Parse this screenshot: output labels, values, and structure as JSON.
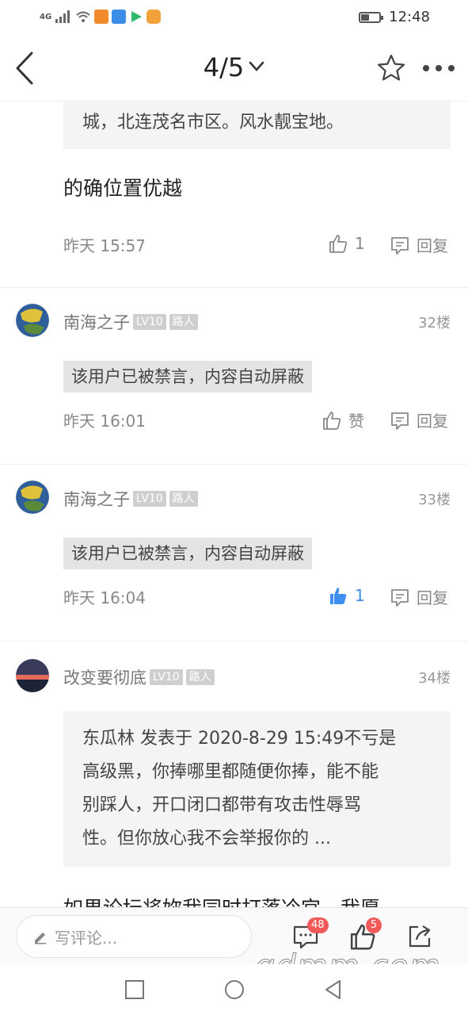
{
  "status_bar": {
    "network": "4G",
    "time": "12:48",
    "battery_level": 0.45
  },
  "header": {
    "page_indicator": "4/5"
  },
  "content": {
    "top_quote": "城，北连茂名市区。风水靓宝地。",
    "top_post_text": "的确位置优越",
    "top_post_time": "昨天 15:57",
    "top_post_likes": "1",
    "reply_label": "回复",
    "comments": [
      {
        "username": "南海之子",
        "level": "LV10",
        "role": "路人",
        "floor": "32楼",
        "text": "该用户已被禁言，内容自动屏蔽",
        "time": "昨天 16:01",
        "like_label": "赞"
      },
      {
        "username": "南海之子",
        "level": "LV10",
        "role": "路人",
        "floor": "33楼",
        "text": "该用户已被禁言，内容自动屏蔽",
        "time": "昨天 16:04",
        "like_label": "1"
      },
      {
        "username": "改变要彻底",
        "level": "LV10",
        "role": "路人",
        "floor": "34楼",
        "quote_lines": [
          "东瓜林 发表于 2020-8-29 15:49不亏是",
          "高级黑，你捧哪里都随便你捧，能不能",
          "别踩人，开口闭口都带有攻击性辱骂",
          "性。但你放心我不会举报你的 ..."
        ],
        "text": "如果论坛将妳我同时打落冷宫，我愿意！！！"
      }
    ]
  },
  "bottom_bar": {
    "comment_placeholder": "写评论...",
    "comment_count": "48",
    "like_count": "5"
  },
  "watermark": "gdmm.com",
  "colors": {
    "accent_blue": "#3d8ef0",
    "badge_red": "#f25a5a"
  }
}
